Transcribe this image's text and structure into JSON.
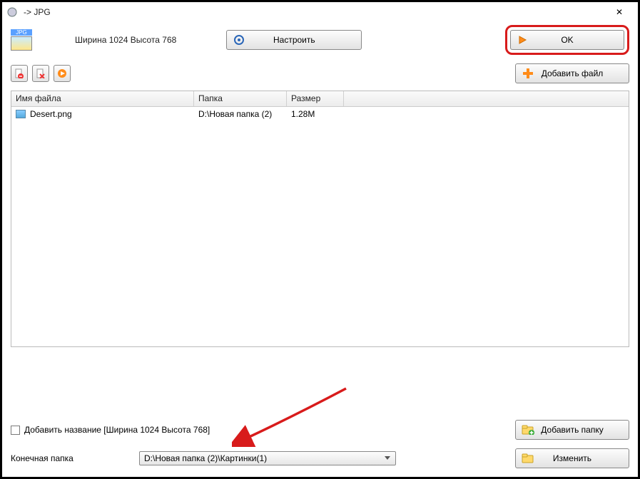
{
  "titlebar": {
    "title": " -> JPG",
    "close": "✕"
  },
  "header": {
    "jpg_badge": "JPG",
    "dimensions": "Ширина 1024 Высота 768",
    "configure": "Настроить",
    "ok": "OK"
  },
  "toolbar": {
    "addfile": "Добавить файл"
  },
  "table": {
    "headers": {
      "name": "Имя файла",
      "folder": "Папка",
      "size": "Размер"
    },
    "rows": [
      {
        "name": "Desert.png",
        "folder": "D:\\Новая папка (2)",
        "size": "1.28M"
      }
    ]
  },
  "footer": {
    "addname_label": "Добавить название [Ширина 1024 Высота 768]",
    "dest_label": "Конечная папка",
    "dest_value": "D:\\Новая папка (2)\\Картинки(1)",
    "addfolder": "Добавить папку",
    "change": "Изменить"
  }
}
